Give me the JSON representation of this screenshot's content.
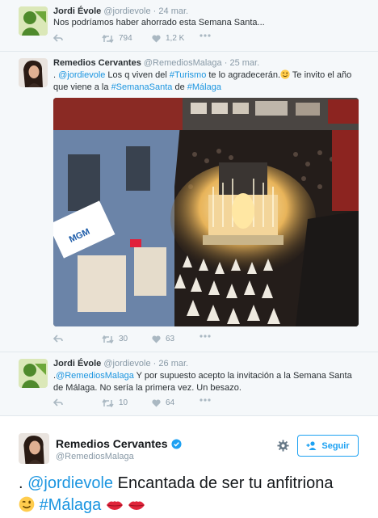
{
  "tweets": [
    {
      "name": "Jordi Évole",
      "handle": "@jordievole",
      "sep": "·",
      "date": "24 mar.",
      "text": "Nos podríamos haber ahorrado esta Semana Santa...",
      "retweets": "794",
      "likes": "1,2 K"
    },
    {
      "name": "Remedios Cervantes",
      "handle": "@RemediosMalaga",
      "sep": "·",
      "date": "25 mar.",
      "text_parts": [
        ". ",
        "@jordievole",
        " Los q viven del ",
        "#Turismo",
        " te lo agradecerán.",
        " Te invito el año que viene a la ",
        "#SemanaSanta",
        " de ",
        "#Málaga"
      ],
      "retweets": "30",
      "likes": "63"
    },
    {
      "name": "Jordi Évole",
      "handle": "@jordievole",
      "sep": "·",
      "date": "26 mar.",
      "text_parts": [
        ".",
        "@RemediosMalaga",
        " Y por supuesto acepto la invitación a la Semana Santa de Málaga. No sería la primera vez. Un besazo."
      ],
      "retweets": "10",
      "likes": "64"
    }
  ],
  "main_tweet": {
    "name": "Remedios Cervantes",
    "handle": "@RemediosMalaga",
    "follow_label": "Seguir",
    "text_parts": [
      ". ",
      "@jordievole",
      " Encantada de ser tu anfitriona",
      "#Málaga"
    ]
  },
  "photo_sign": "MGM",
  "colors": {
    "link": "#1b95e0",
    "verified": "#1da1f2",
    "bg_card": "#f5f8fa",
    "like_icon": "#aab8c2"
  },
  "icons": [
    "reply-icon",
    "retweet-icon",
    "like-icon",
    "more-icon",
    "verified-icon",
    "gear-icon",
    "follow-person-icon",
    "wink-emoji-icon",
    "kiss-lips-icon"
  ]
}
